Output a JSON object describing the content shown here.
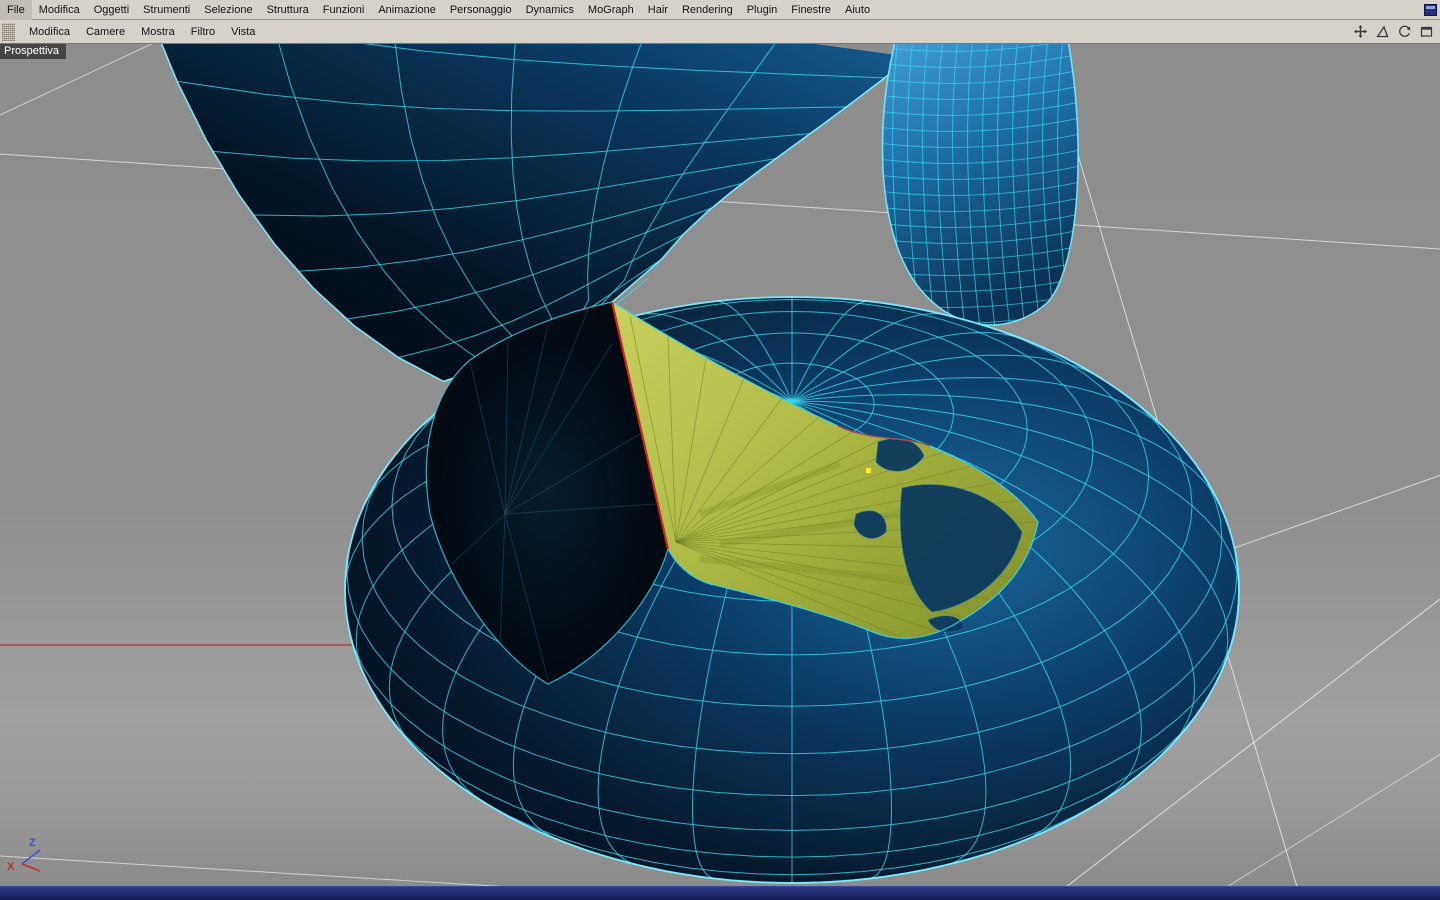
{
  "menubar": {
    "items": [
      "File",
      "Modifica",
      "Oggetti",
      "Strumenti",
      "Selezione",
      "Struttura",
      "Funzioni",
      "Animazione",
      "Personaggio",
      "Dynamics",
      "MoGraph",
      "Hair",
      "Rendering",
      "Plugin",
      "Finestre",
      "Aiuto"
    ]
  },
  "viewport_toolbar": {
    "items": [
      "Modifica",
      "Camere",
      "Mostra",
      "Filtro",
      "Vista"
    ]
  },
  "viewport": {
    "label": "Prospettiva",
    "axis": {
      "z": "Z",
      "x": "X"
    }
  },
  "icons": {
    "menubar_right": "window-grid-icon",
    "viewport_bar": [
      "camera-move-icon",
      "camera-scale-icon",
      "camera-rotate-icon",
      "viewport-toggle-icon"
    ]
  },
  "scene": {
    "colors": {
      "background": "#909090",
      "background_band": "#a0a0a0",
      "grid_line": "#ededed",
      "axis_red": "#b23028",
      "wire": "#37d9f0",
      "wire_bright": "#7deeff",
      "body_dark": "#020a14",
      "body_mid": "#0b3d68",
      "body_light": "#1a679c",
      "shoulder_light": "#46a2da",
      "selection_fill": "#b0bc47",
      "selection_dark": "#86962e",
      "seam_red": "#cf2424",
      "axis_z": "#3c50e0",
      "axis_x": "#c03028",
      "label_bg": "#454545",
      "label_text": "#ffffff",
      "bottombar": "#1e2a6e"
    }
  }
}
